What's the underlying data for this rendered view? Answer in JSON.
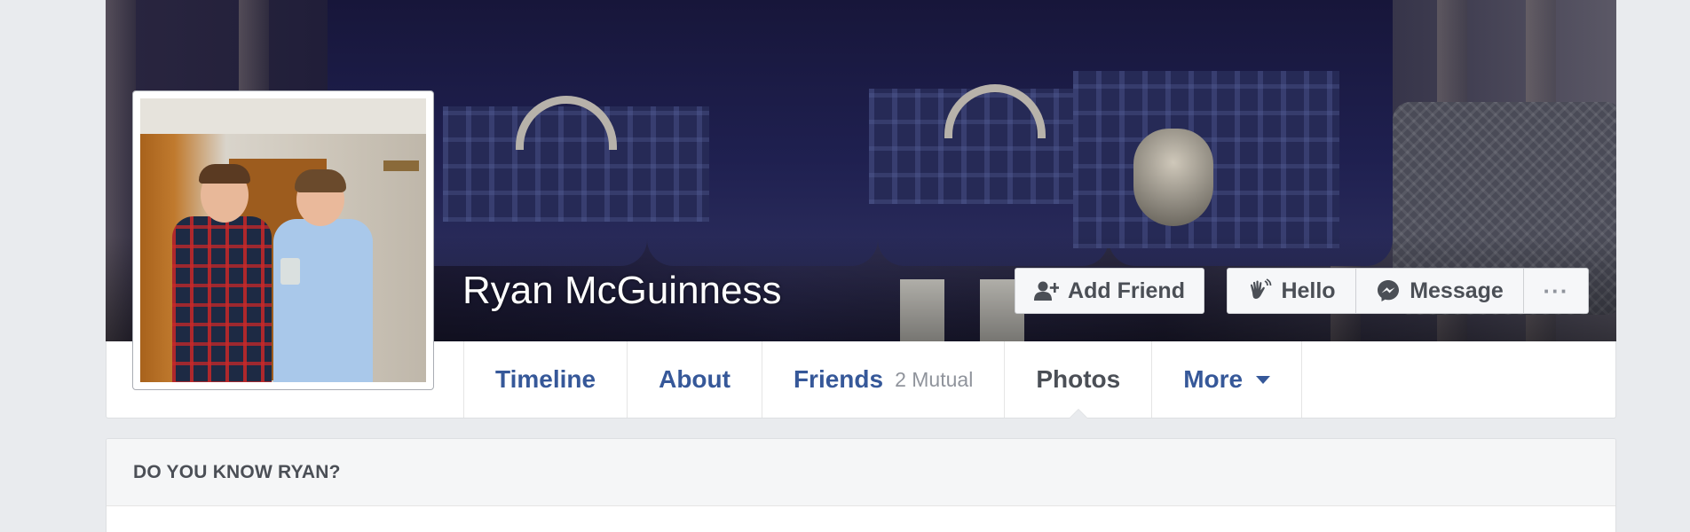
{
  "profile": {
    "name": "Ryan McGuinness"
  },
  "actions": {
    "add_friend": "Add Friend",
    "hello": "Hello",
    "message": "Message",
    "more": "···"
  },
  "tabs": [
    {
      "label": "Timeline"
    },
    {
      "label": "About"
    },
    {
      "label": "Friends",
      "sub": "2 Mutual"
    },
    {
      "label": "Photos"
    },
    {
      "label": "More"
    }
  ],
  "active_tab": "Photos",
  "know_card": {
    "title": "DO YOU KNOW RYAN?"
  },
  "colors": {
    "link": "#365899",
    "button_text": "#4b4f56",
    "page_bg": "#e9ebee"
  },
  "icons": {
    "add_friend": "add-friend-icon",
    "hello": "wave-icon",
    "message": "messenger-icon",
    "more_tab": "caret-down-icon"
  }
}
